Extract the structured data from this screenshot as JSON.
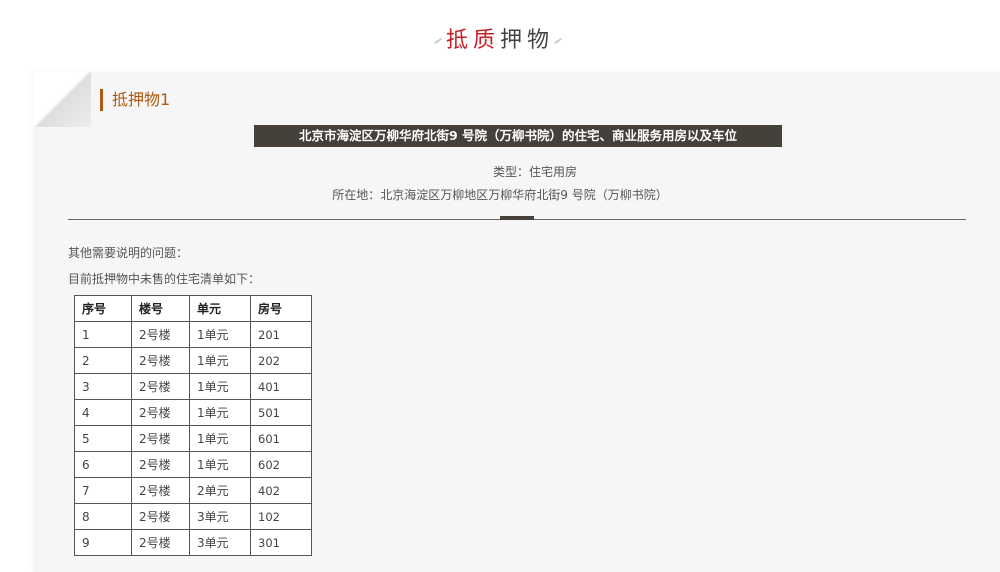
{
  "section": {
    "title_red": "抵质",
    "title_dark": "押物"
  },
  "item": {
    "heading": "抵押物1",
    "address_banner": "北京市海淀区万柳华府北街9 号院（万柳书院）的住宅、商业服务用房以及车位",
    "type_line": "类型：住宅用房",
    "location_line": "所在地：北京海淀区万柳地区万柳华府北街9 号院（万柳书院）"
  },
  "notes": {
    "line1": "其他需要说明的问题：",
    "line2": "目前抵押物中未售的住宅清单如下："
  },
  "table": {
    "headers": [
      "序号",
      "楼号",
      "单元",
      "房号"
    ],
    "rows": [
      [
        "1",
        "2号楼",
        "1单元",
        "201"
      ],
      [
        "2",
        "2号楼",
        "1单元",
        "202"
      ],
      [
        "3",
        "2号楼",
        "1单元",
        "401"
      ],
      [
        "4",
        "2号楼",
        "1单元",
        "501"
      ],
      [
        "5",
        "2号楼",
        "1单元",
        "601"
      ],
      [
        "6",
        "2号楼",
        "1单元",
        "602"
      ],
      [
        "7",
        "2号楼",
        "2单元",
        "402"
      ],
      [
        "8",
        "2号楼",
        "3单元",
        "102"
      ],
      [
        "9",
        "2号楼",
        "3单元",
        "301"
      ]
    ]
  },
  "colors": {
    "accent_red": "#c8202a",
    "heading_orange": "#b05a10",
    "banner_dark": "#45403a"
  }
}
